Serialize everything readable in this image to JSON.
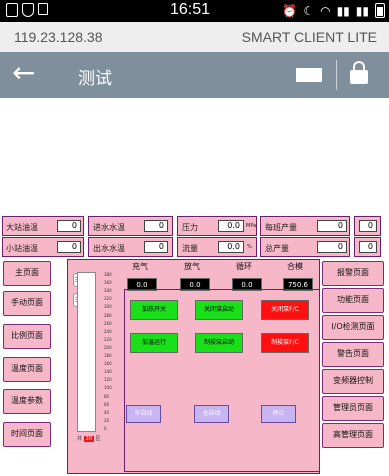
{
  "status_bar": {
    "time": "16:51"
  },
  "header": {
    "server_address": "119.23.128.38",
    "app_name": "SMART CLIENT LITE",
    "title": "测试"
  },
  "readings": [
    {
      "label": "大站油温",
      "value": "0"
    },
    {
      "label": "进水水温",
      "value": "0"
    },
    {
      "label": "压力",
      "value": "0.0",
      "unit": "MPa"
    },
    {
      "label": "每班产量",
      "value": "0"
    },
    {
      "label": "",
      "value": "0"
    },
    {
      "label": "小站油温",
      "value": "0"
    },
    {
      "label": "出水水温",
      "value": "0"
    },
    {
      "label": "流量",
      "value": "0.0",
      "unit": "%"
    },
    {
      "label": "总产量",
      "value": "0"
    },
    {
      "label": "",
      "value": "0"
    }
  ],
  "left_nav": [
    "主页面",
    "手动页面",
    "比例页面",
    "温度页面",
    "温度参数",
    "时间页面"
  ],
  "right_nav": [
    "报警页面",
    "功能页面",
    "I/O检测页面",
    "警告页面",
    "变频器控制",
    "管理员页面",
    "高管理页面"
  ],
  "process": {
    "columns": [
      "充气",
      "放气",
      "循环",
      "合模"
    ],
    "values": [
      "0.0",
      "0.0",
      "0.0",
      "750.6"
    ],
    "machines": [
      "主机A",
      "主机B"
    ],
    "gauge_ticks": [
      "380",
      "360",
      "340",
      "320",
      "300",
      "280",
      "260",
      "240",
      "220",
      "200",
      "180",
      "160",
      "140",
      "120",
      "100",
      "80",
      "60",
      "40",
      "20",
      "0"
    ],
    "buttons_green": [
      "加热开关",
      "关闭泵启动",
      "加温运行",
      "制梭泵启动"
    ],
    "buttons_red": [
      "关闭泵F/C",
      "制梭泵F/C"
    ],
    "mode_buttons": [
      "半自动",
      "全自动",
      "停止"
    ],
    "footer_left": "共",
    "footer_value": "20",
    "footer_right": "区"
  },
  "colors": {
    "panel_pink": "#f6b8c8",
    "border_purple": "#6a1f6e",
    "nav_gray": "#7f8f9c",
    "green": "#1ae01a",
    "red": "#ff1010"
  }
}
